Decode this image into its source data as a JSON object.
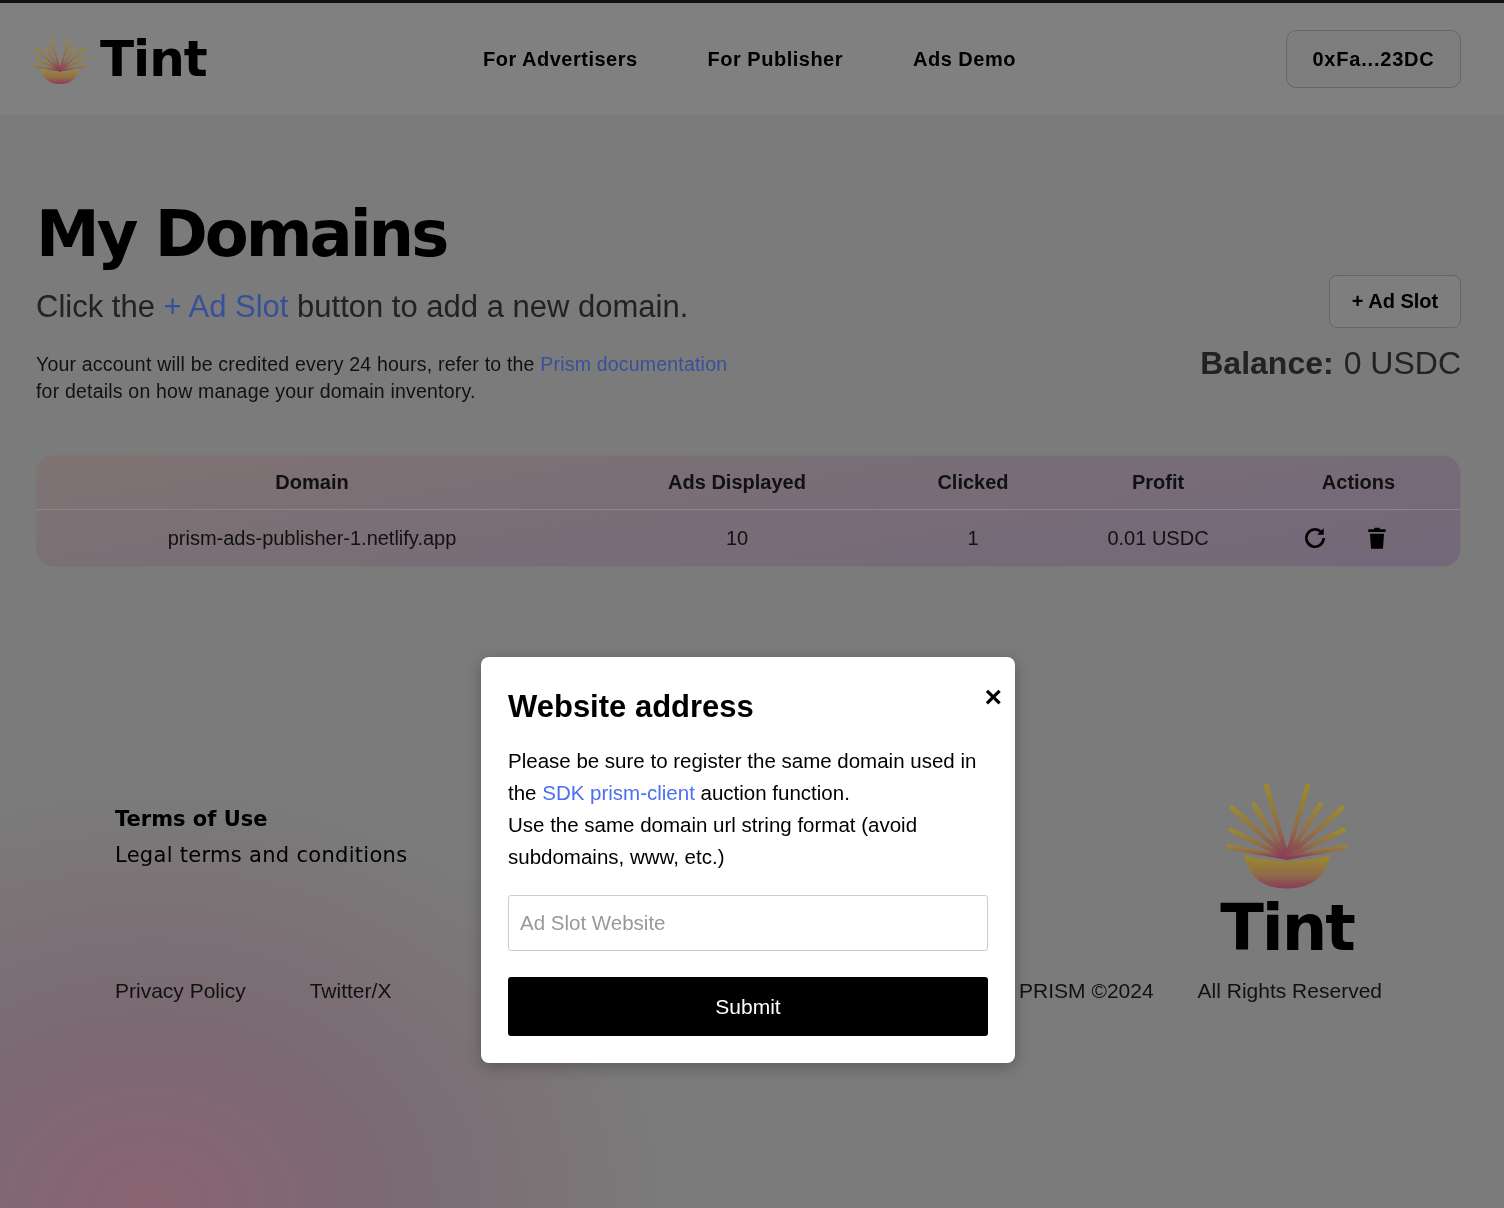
{
  "header": {
    "brand": "Tint",
    "nav": [
      {
        "label": "For Advertisers"
      },
      {
        "label": "For Publisher"
      },
      {
        "label": "Ads Demo"
      }
    ],
    "wallet_button": "0xFa...23DC"
  },
  "page": {
    "title": "My Domains",
    "intro_before": "Click the ",
    "intro_link": "+ Ad Slot",
    "intro_after": " button to add a new domain.",
    "note_before": "Your account will be credited every 24 hours, refer to the ",
    "note_link": "Prism documentation",
    "note_after": "for details on how manage your domain inventory.",
    "add_button": "+ Ad Slot",
    "balance_label": "Balance:",
    "balance_value": "0 USDC"
  },
  "table": {
    "columns": [
      "Domain",
      "Ads Displayed",
      "Clicked",
      "Profit",
      "Actions"
    ],
    "rows": [
      {
        "domain": "prism-ads-publisher-1.netlify.app",
        "ads_displayed": "10",
        "clicked": "1",
        "profit": "0.01 USDC"
      }
    ]
  },
  "footer": {
    "terms_title": "Terms of Use",
    "terms_text": "Legal terms and conditions",
    "links": [
      "Privacy Policy",
      "Twitter/X"
    ],
    "copyright": "PRISM ©2024",
    "rights": "All Rights Reserved",
    "brand": "Tint"
  },
  "modal": {
    "title": "Website address",
    "close": "×",
    "p1_before": "Please be sure to register the same domain used in the ",
    "p1_link": "SDK prism-client",
    "p1_after": " auction function.",
    "p2": "Use the same domain url string format (avoid subdomains, www, etc.)",
    "placeholder": "Ad Slot Website",
    "submit": "Submit"
  }
}
